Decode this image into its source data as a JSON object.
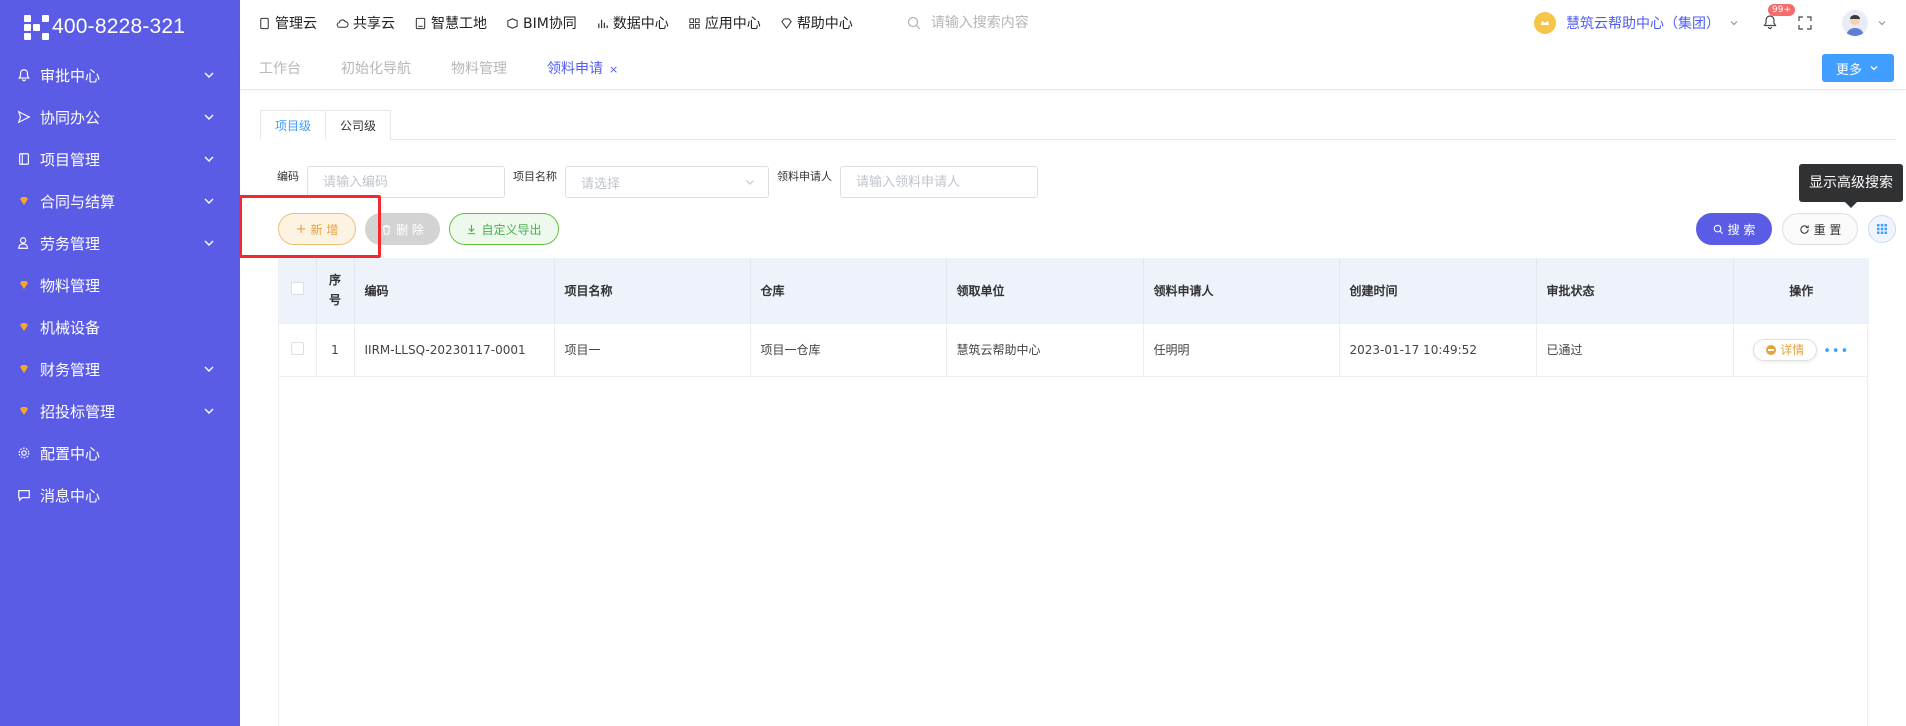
{
  "brand": {
    "phone": "400-8228-321"
  },
  "sidebar": {
    "items": [
      {
        "label": "审批中心",
        "icon": "bell-icon",
        "has_children": true
      },
      {
        "label": "协同办公",
        "icon": "send-icon",
        "has_children": true
      },
      {
        "label": "项目管理",
        "icon": "book-icon",
        "has_children": true
      },
      {
        "label": "合同与结算",
        "icon": "gem-icon",
        "has_children": true
      },
      {
        "label": "劳务管理",
        "icon": "worker-icon",
        "has_children": true
      },
      {
        "label": "物料管理",
        "icon": "gem-icon",
        "has_children": false
      },
      {
        "label": "机械设备",
        "icon": "gem-icon",
        "has_children": false
      },
      {
        "label": "财务管理",
        "icon": "gem-icon",
        "has_children": true
      },
      {
        "label": "招投标管理",
        "icon": "gem-icon",
        "has_children": true
      },
      {
        "label": "配置中心",
        "icon": "gear-icon",
        "has_children": false
      },
      {
        "label": "消息中心",
        "icon": "message-icon",
        "has_children": false
      }
    ]
  },
  "topbar": {
    "links": [
      {
        "label": "管理云",
        "icon": "phone-icon"
      },
      {
        "label": "共享云",
        "icon": "cloud-icon"
      },
      {
        "label": "智慧工地",
        "icon": "book-icon"
      },
      {
        "label": "BIM协同",
        "icon": "cube-icon"
      },
      {
        "label": "数据中心",
        "icon": "bar-chart-icon"
      },
      {
        "label": "应用中心",
        "icon": "apps-icon"
      },
      {
        "label": "帮助中心",
        "icon": "diamond-icon"
      }
    ],
    "search_placeholder": "请输入搜索内容",
    "org_name": "慧筑云帮助中心（集团）",
    "notification_badge": "99+"
  },
  "page_tabs": [
    {
      "label": "工作台",
      "active": false
    },
    {
      "label": "初始化导航",
      "active": false
    },
    {
      "label": "物料管理",
      "active": false
    },
    {
      "label": "领料申请",
      "active": true,
      "closable": true
    }
  ],
  "close_mark": "×",
  "more_label": "更多",
  "level_tabs": [
    {
      "label": "项目级",
      "active": true
    },
    {
      "label": "公司级",
      "active": false
    }
  ],
  "filters": {
    "code_label": "编码",
    "code_placeholder": "请输入编码",
    "project_label": "项目名称",
    "project_placeholder": "请选择",
    "applicant_label": "领料申请人",
    "applicant_placeholder": "请输入领料申请人"
  },
  "actions": {
    "add": "新 增",
    "delete": "删 除",
    "export": "自定义导出",
    "search": "搜 索",
    "reset": "重 置",
    "advanced_tooltip": "显示高级搜索"
  },
  "table": {
    "columns": [
      "序号",
      "编码",
      "项目名称",
      "仓库",
      "领取单位",
      "领料申请人",
      "创建时间",
      "审批状态",
      "操作"
    ],
    "rows": [
      {
        "no": "1",
        "code": "IIRM-LLSQ-20230117-0001",
        "project": "项目一",
        "warehouse": "项目一仓库",
        "unit": "慧筑云帮助中心",
        "applicant": "任明明",
        "created": "2023-01-17 10:49:52",
        "status": "已通过",
        "detail_label": "详情"
      }
    ]
  },
  "colors": {
    "sidebar_bg": "#5b5ce6",
    "accent": "#409eff",
    "highlight_frame": "#f4292e"
  }
}
